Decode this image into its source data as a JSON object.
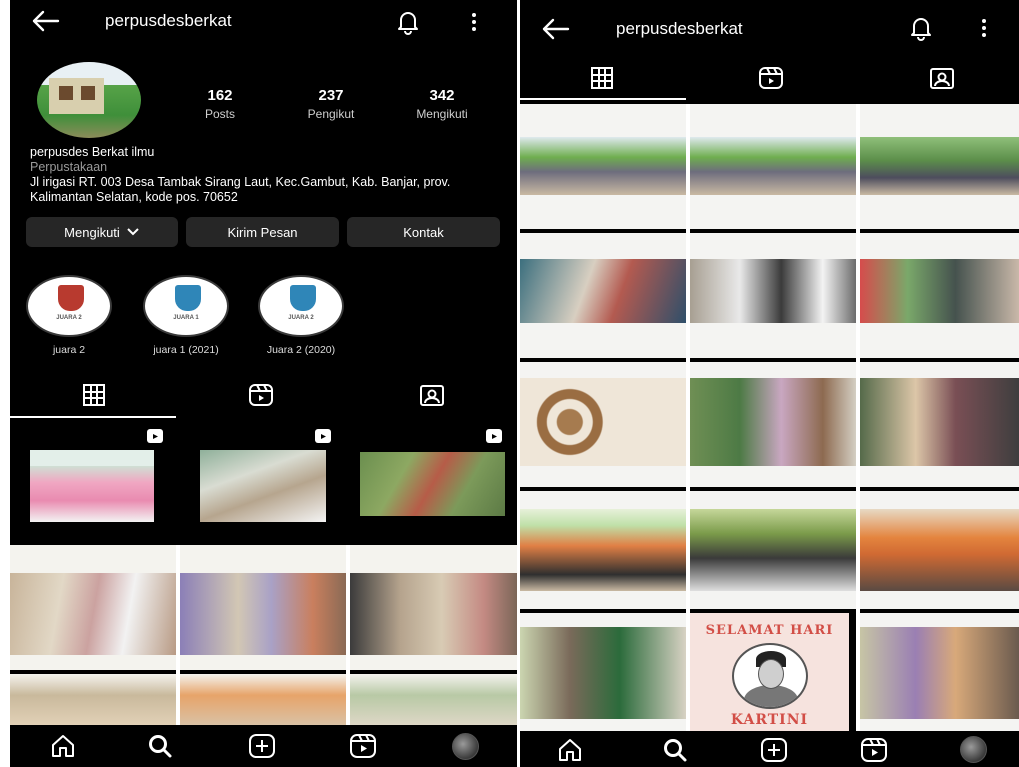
{
  "left": {
    "header": {
      "username": "perpusdesberkat"
    },
    "profile": {
      "stats": [
        {
          "value": "162",
          "label": "Posts"
        },
        {
          "value": "237",
          "label": "Pengikut"
        },
        {
          "value": "342",
          "label": "Mengikuti"
        }
      ],
      "name": "perpusdes Berkat ilmu",
      "category": "Perpustakaan",
      "address": "Jl irigasi RT. 003 Desa Tambak Sirang Laut, Kec.Gambut, Kab. Banjar, prov. Kalimantan Selatan, kode pos. 70652"
    },
    "buttons": {
      "following": "Mengikuti",
      "message": "Kirim Pesan",
      "contact": "Kontak"
    },
    "highlights": [
      {
        "label": "juara 2",
        "badge": "JUARA 2",
        "color": "#b83a2f"
      },
      {
        "label": "juara 1 (2021)",
        "badge": "JUARA 1",
        "color": "#2f86b8"
      },
      {
        "label": "Juara 2 (2020)",
        "badge": "JUARA 2",
        "color": "#2f86b8"
      }
    ]
  },
  "right": {
    "header": {
      "username": "perpusdesberkat"
    },
    "kartini": {
      "line1": "SELAMAT HARI",
      "line2": "KARTINI"
    }
  },
  "colors": {
    "background": "#000000",
    "button": "#262626",
    "text": "#ffffff",
    "muted": "#9a9a9a"
  },
  "icons": [
    "back-arrow-icon",
    "bell-icon",
    "more-icon",
    "grid-icon",
    "reels-icon",
    "tagged-icon",
    "home-icon",
    "search-icon",
    "add-icon",
    "reels-nav-icon",
    "profile-avatar-icon"
  ]
}
